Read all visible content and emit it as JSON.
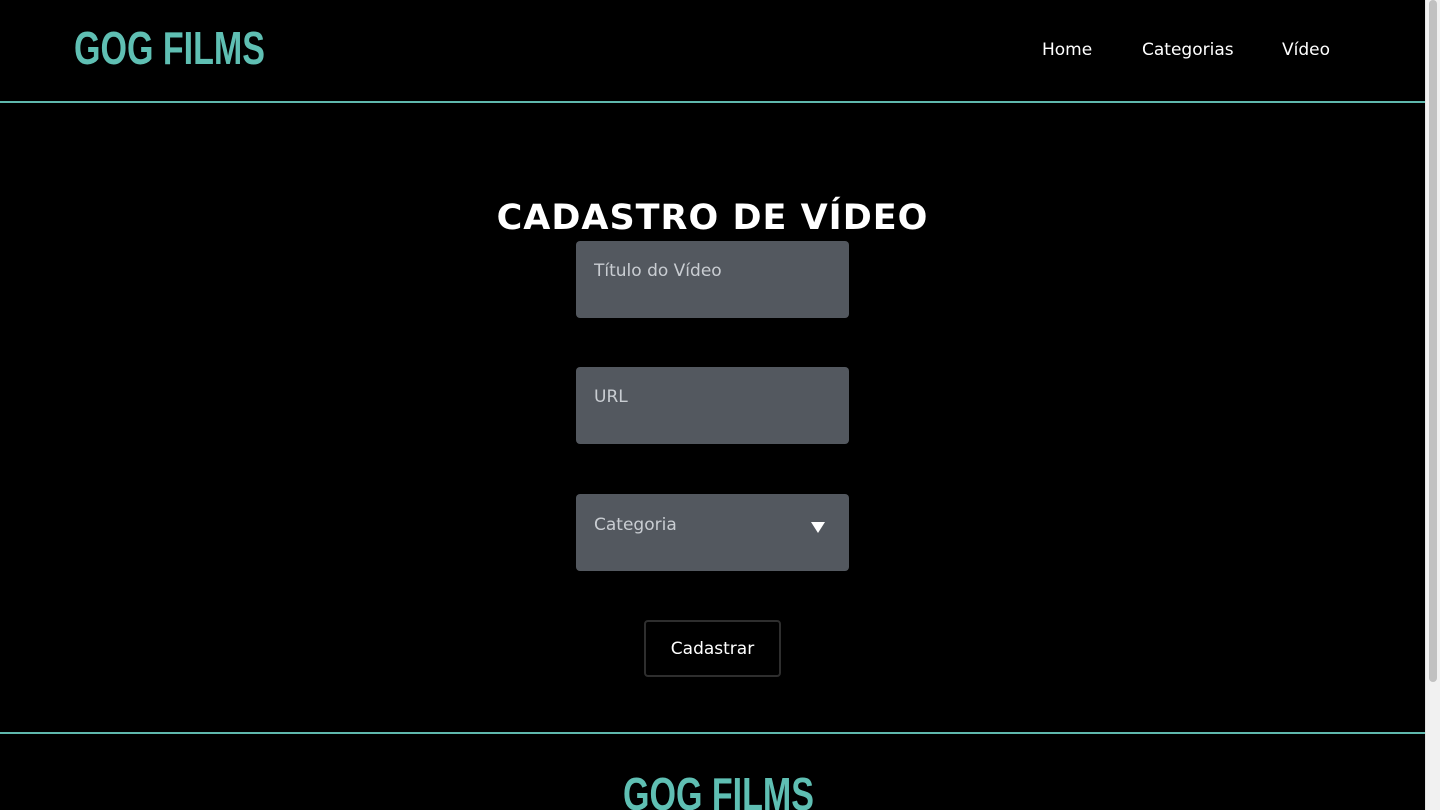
{
  "header": {
    "logo": "GOG FILMS",
    "nav": {
      "home": "Home",
      "categories": "Categorias",
      "video": "Vídeo"
    }
  },
  "form": {
    "title": "CADASTRO DE VÍDEO",
    "video_title_placeholder": "Título do Vídeo",
    "url_placeholder": "URL",
    "category_placeholder": "Categoria",
    "submit_label": "Cadastrar"
  },
  "footer": {
    "logo": "GOG FILMS"
  },
  "colors": {
    "brand": "#5fbfb3",
    "field_background": "#53585f",
    "background": "#000000"
  },
  "icons": {
    "select_arrow": "triangle-down"
  }
}
